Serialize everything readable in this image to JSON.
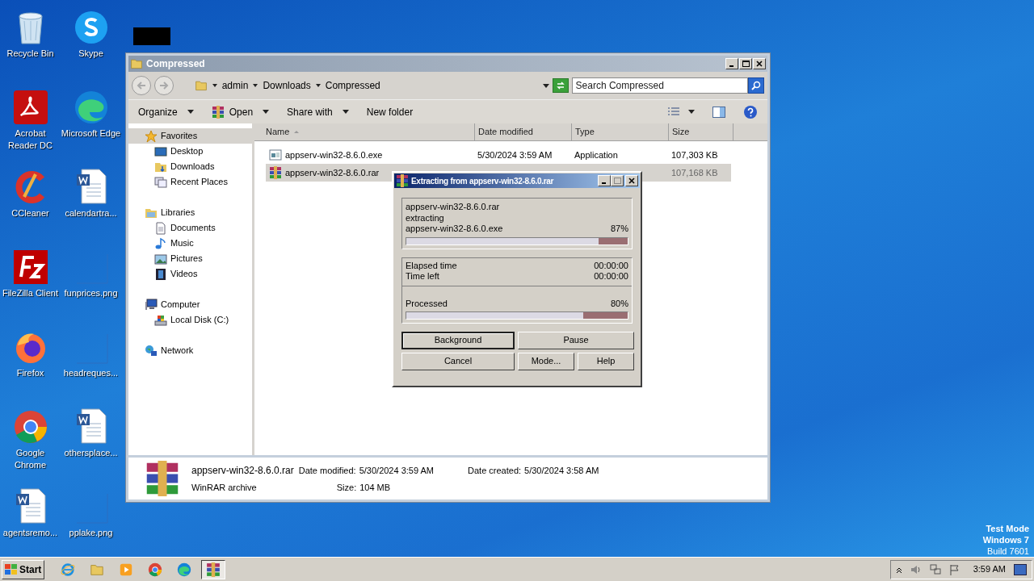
{
  "desktop_icons": [
    {
      "kind": "recycle",
      "label": "Recycle Bin"
    },
    {
      "kind": "skype",
      "label": "Skype"
    },
    {
      "kind": "redacted"
    },
    {
      "kind": "acrobat",
      "label": "Acrobat Reader DC"
    },
    {
      "kind": "edge",
      "label": "Microsoft Edge"
    },
    {
      "kind": "blank"
    },
    {
      "kind": "ccleaner",
      "label": "CCleaner"
    },
    {
      "kind": "word",
      "label": "calendartra..."
    },
    {
      "kind": "blank"
    },
    {
      "kind": "filezilla",
      "label": "FileZilla Client"
    },
    {
      "kind": "image",
      "label": "funprices.png"
    },
    {
      "kind": "blank"
    },
    {
      "kind": "firefox",
      "label": "Firefox"
    },
    {
      "kind": "image",
      "label": "headreques..."
    },
    {
      "kind": "blank"
    },
    {
      "kind": "chrome",
      "label": "Google Chrome"
    },
    {
      "kind": "word",
      "label": "othersplace..."
    },
    {
      "kind": "blank"
    },
    {
      "kind": "word",
      "label": "agentsremo..."
    },
    {
      "kind": "image",
      "label": "pplake.png"
    }
  ],
  "explorer": {
    "title": "Compressed",
    "breadcrumb": [
      "admin",
      "Downloads",
      "Compressed"
    ],
    "search": {
      "placeholder": "Search Compressed"
    },
    "toolbar": [
      {
        "label": "Organize",
        "dropdown": true,
        "kind": "plain"
      },
      {
        "label": "Open",
        "dropdown": true,
        "kind": "winrar"
      },
      {
        "label": "Share with",
        "dropdown": true,
        "kind": "plain"
      },
      {
        "label": "New folder",
        "dropdown": false,
        "kind": "plain"
      }
    ],
    "nav": [
      {
        "kind": "star",
        "label": "Favorites",
        "selected": true,
        "children": [
          {
            "kind": "desktop",
            "label": "Desktop",
            "selected": false
          },
          {
            "kind": "downloads",
            "label": "Downloads",
            "selected": false
          },
          {
            "kind": "recent",
            "label": "Recent Places",
            "selected": false
          }
        ]
      },
      {
        "kind": "libraries",
        "label": "Libraries",
        "selected": false,
        "children": [
          {
            "kind": "documents",
            "label": "Documents",
            "selected": false
          },
          {
            "kind": "music",
            "label": "Music",
            "selected": false
          },
          {
            "kind": "pictures",
            "label": "Pictures",
            "selected": false
          },
          {
            "kind": "videos",
            "label": "Videos",
            "selected": false
          }
        ]
      },
      {
        "kind": "computer",
        "label": "Computer",
        "selected": false,
        "children": [
          {
            "kind": "disk",
            "label": "Local Disk (C:)",
            "selected": false
          }
        ]
      },
      {
        "kind": "network",
        "label": "Network",
        "selected": false
      }
    ],
    "columns": [
      "Name",
      "Date modified",
      "Type",
      "Size"
    ],
    "rows": [
      {
        "kind": "exe",
        "name": "appserv-win32-8.6.0.exe",
        "date": "5/30/2024 3:59 AM",
        "type": "Application",
        "size": "107,303 KB",
        "selected": false
      },
      {
        "kind": "winrar",
        "name": "appserv-win32-8.6.0.rar",
        "size": "107,168 KB",
        "selected": true
      }
    ],
    "details": {
      "name": "appserv-win32-8.6.0.rar",
      "type": "WinRAR archive",
      "modified_label": "Date modified:",
      "modified": "5/30/2024 3:59 AM",
      "size_label": "Size:",
      "size": "104 MB",
      "created_label": "Date created:",
      "created": "5/30/2024 3:58 AM"
    }
  },
  "dialog": {
    "title": "Extracting from appserv-win32-8.6.0.rar",
    "archive": "appserv-win32-8.6.0.rar",
    "action": "extracting",
    "file": "appserv-win32-8.6.0.exe",
    "file_progress": {
      "percent": "87%",
      "level": 0.87
    },
    "elapsed_label": "Elapsed time",
    "elapsed": "00:00:00",
    "left_label": "Time left",
    "left": "00:00:00",
    "processed_label": "Processed",
    "processed_progress": {
      "percent": "80%",
      "level": 0.8
    },
    "buttons": [
      {
        "label": "Background",
        "default": true
      },
      {
        "label": "Pause",
        "default": false
      },
      {
        "label": "Cancel",
        "default": false
      },
      {
        "label": "Mode...",
        "default": false
      },
      {
        "label": "Help",
        "default": false
      }
    ]
  },
  "taskbar": {
    "start": "Start",
    "apps": [
      {
        "kind": "ie",
        "active": false
      },
      {
        "kind": "folder",
        "active": false
      },
      {
        "kind": "media",
        "active": false
      },
      {
        "kind": "chrome",
        "active": false
      },
      {
        "kind": "edge",
        "active": false
      },
      {
        "kind": "winrar",
        "active": true
      }
    ],
    "clock": "3:59 AM"
  },
  "watermark_text": [
    "Test Mode",
    "Windows 7",
    "Build 7601"
  ]
}
